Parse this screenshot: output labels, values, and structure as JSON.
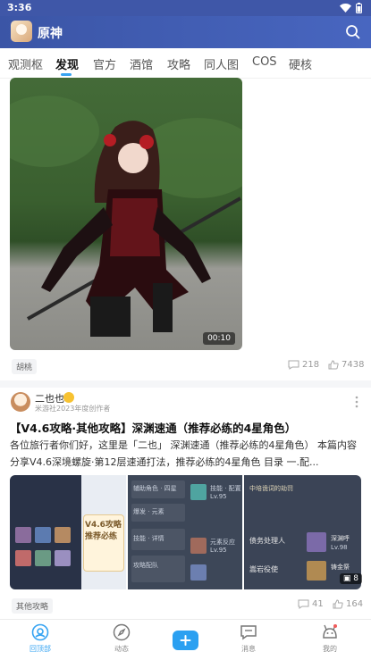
{
  "status_bar": {
    "time": "3:36"
  },
  "header": {
    "game_title": "原神"
  },
  "tabs": [
    {
      "label": "观测枢"
    },
    {
      "label": "发现"
    },
    {
      "label": "官方"
    },
    {
      "label": "酒馆"
    },
    {
      "label": "攻略"
    },
    {
      "label": "同人图"
    },
    {
      "label": "COS"
    },
    {
      "label": "硬核"
    }
  ],
  "first_post": {
    "duration": "00:10",
    "tag": "胡桃",
    "comments": "218",
    "likes": "7438"
  },
  "second_post": {
    "author_name": "二也也",
    "author_subtitle": "米游社2023年度创作者",
    "title": "【V4.6攻略·其他攻略】深渊速通（推荐必练的4星角色）",
    "body": "各位旅行者你们好，这里是「二也」 深渊速通（推荐必练的4星角色） 本篇内容 分享V4.6深境螺旋·第12层速通打法，推荐必练的4星角色 目录 一.配...",
    "thumb1_text": "V4.6攻略 推荐必练",
    "thumb2_lines": [
      "辅助角色 · 四星",
      "爆发 · 元素",
      "技能 · 详情",
      "攻略配队",
      "技能 · 配置",
      "元素反应"
    ],
    "thumb2_levels": [
      "Lv.95",
      "Lv.95"
    ],
    "thumb3_lines": [
      "中培诡词的劫罚",
      "债务处理人",
      "深渊呼",
      "Lv.98",
      "嵩岩役使",
      "铸金祭"
    ],
    "image_count": "8",
    "tag": "其他攻略",
    "comments": "41",
    "likes": "164"
  },
  "bottom_nav": [
    {
      "label": "回顶部",
      "icon": "home-icon"
    },
    {
      "label": "动态",
      "icon": "compass-icon"
    },
    {
      "label": "",
      "icon": "plus-icon"
    },
    {
      "label": "消息",
      "icon": "message-icon"
    },
    {
      "label": "我的",
      "icon": "profile-icon"
    }
  ],
  "colors": {
    "header": "#4560b5",
    "accent": "#37a4f2"
  }
}
